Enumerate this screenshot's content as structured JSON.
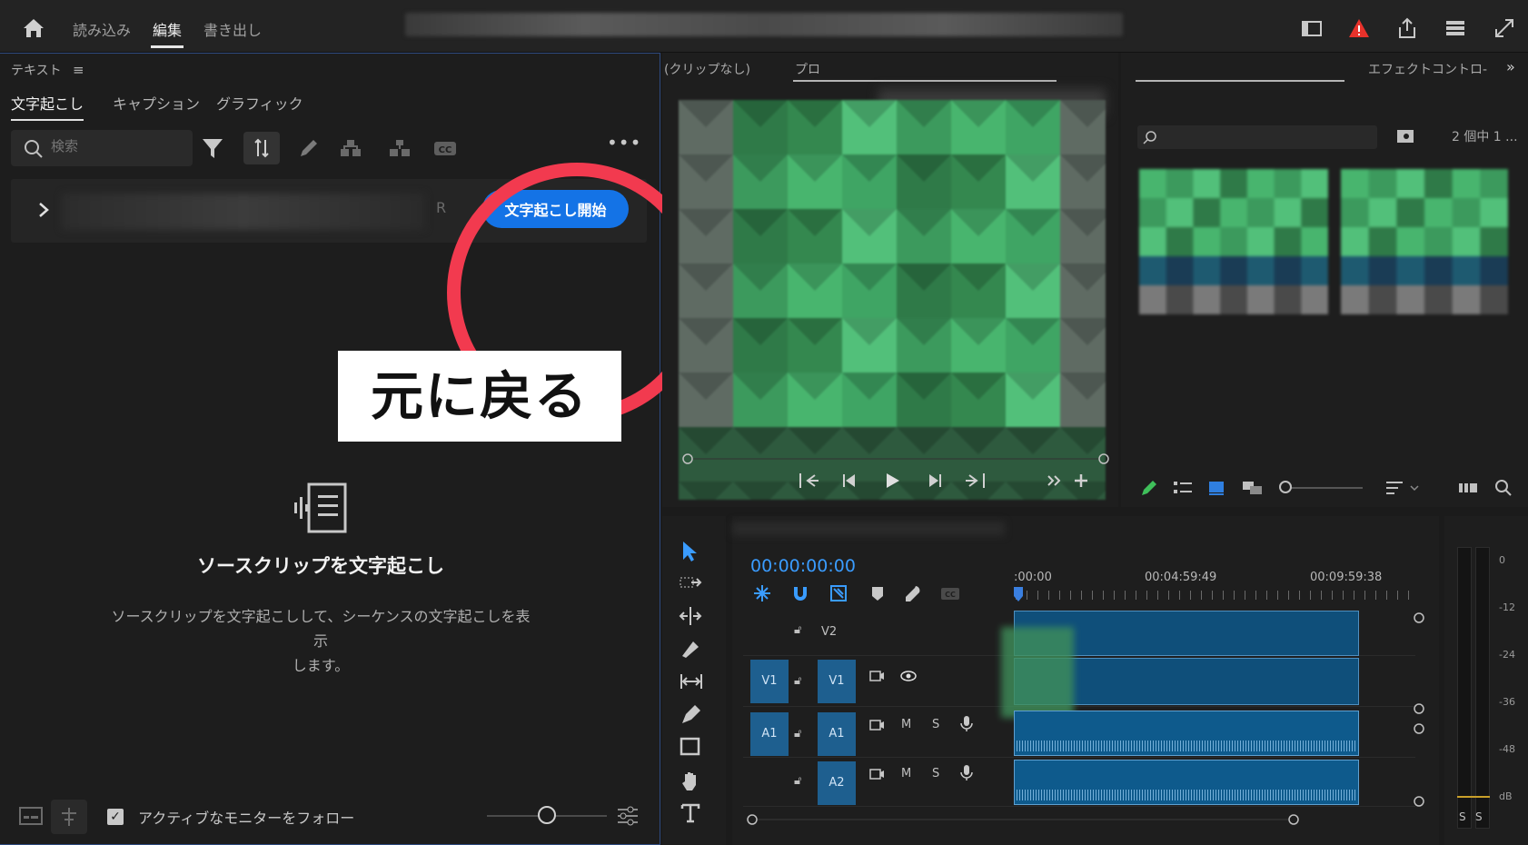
{
  "topbar": {
    "tabs": [
      "読み込み",
      "編集",
      "書き出し"
    ],
    "active_tab": "編集"
  },
  "text_panel": {
    "title": "テキスト",
    "tabs": [
      "文字起こし",
      "キャプション",
      "グラフィック"
    ],
    "search_placeholder": "検索",
    "row_fragment": "R",
    "transcribe_button": "文字起こし開始",
    "callout": "元に戻る",
    "empty_title": "ソースクリップを文字起こし",
    "empty_desc_line1": "ソースクリップを文字起こしして、シーケンスの文字起こしを表示",
    "empty_desc_line2": "します。",
    "follow_label": "アクティブなモニターをフォロー"
  },
  "monitor": {
    "tab_source": "(クリップなし)",
    "tab_program": "プロ"
  },
  "project": {
    "tab_effect": "エフェクトコントロ-",
    "item_count": "2 個中 1 ..."
  },
  "timeline": {
    "timecode": "00:00:00:00",
    "ruler": [
      ":00:00",
      "00:04:59:49",
      "00:09:59:38"
    ],
    "tracks": [
      {
        "target": "",
        "name": "V2",
        "controls": []
      },
      {
        "target": "V1",
        "name": "V1",
        "controls": []
      },
      {
        "target": "A1",
        "name": "A1",
        "controls": [
          "M",
          "S"
        ]
      },
      {
        "target": "",
        "name": "A2",
        "controls": [
          "M",
          "S"
        ]
      }
    ]
  },
  "meter": {
    "labels": [
      "0",
      "-12",
      "-24",
      "-36",
      "-48",
      "dB"
    ],
    "solo": [
      "S",
      "S"
    ]
  },
  "colors": {
    "accent_blue": "#1473e6",
    "highlight_red": "#f23a4f",
    "timecode_blue": "#3a9cff",
    "clip_blue": "#0e5a8c"
  }
}
